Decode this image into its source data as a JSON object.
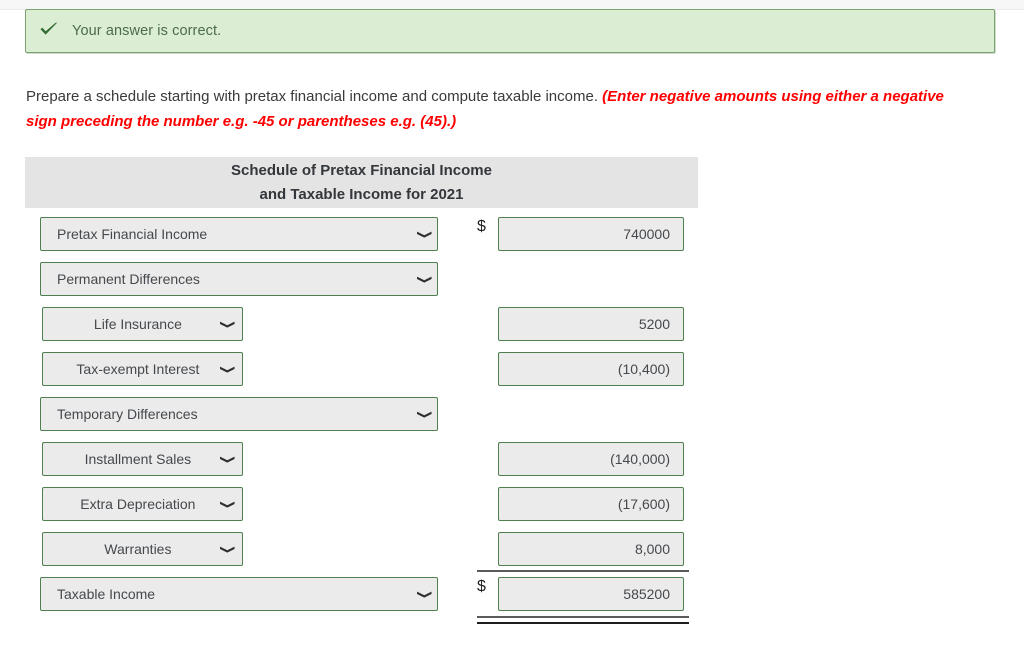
{
  "alert": {
    "icon": "checkmark-icon",
    "message": "Your answer is correct."
  },
  "instruction": {
    "main": "Prepare a schedule starting with pretax financial income and compute taxable income. ",
    "emphasis": "(Enter negative amounts using either a negative sign preceding the number e.g. -45 or parentheses e.g. (45).)"
  },
  "schedule": {
    "title_line1": "Schedule of Pretax Financial Income",
    "title_line2": "and Taxable Income for 2021",
    "currency_symbol": "$",
    "rows": [
      {
        "id": "pretax-financial-income",
        "label": "Pretax Financial Income",
        "style": "wide",
        "currency": true,
        "amount": "740000",
        "has_amount": true
      },
      {
        "id": "permanent-differences",
        "label": "Permanent Differences",
        "style": "wide",
        "currency": false,
        "amount": "",
        "has_amount": false
      },
      {
        "id": "life-insurance",
        "label": "Life Insurance",
        "style": "indent",
        "currency": false,
        "amount": "5200",
        "has_amount": true
      },
      {
        "id": "tax-exempt-interest",
        "label": "Tax-exempt Interest",
        "style": "indent",
        "currency": false,
        "amount": "(10,400)",
        "has_amount": true
      },
      {
        "id": "temporary-differences",
        "label": "Temporary Differences",
        "style": "wide",
        "currency": false,
        "amount": "",
        "has_amount": false
      },
      {
        "id": "installment-sales",
        "label": "Installment Sales",
        "style": "indent",
        "currency": false,
        "amount": "(140,000)",
        "has_amount": true
      },
      {
        "id": "extra-depreciation",
        "label": "Extra Depreciation",
        "style": "indent",
        "currency": false,
        "amount": "(17,600)",
        "has_amount": true
      },
      {
        "id": "warranties",
        "label": "Warranties",
        "style": "indent",
        "currency": false,
        "amount": "8,000",
        "has_amount": true
      },
      {
        "id": "taxable-income",
        "label": "Taxable Income",
        "style": "wide",
        "currency": true,
        "amount": "585200",
        "has_amount": true
      }
    ]
  },
  "colors": {
    "alert_bg": "#dbedd3",
    "alert_border": "#79a46f",
    "alert_text": "#4d6b4d",
    "emphasis_red": "#ff0000",
    "field_bg": "#ebebeb",
    "field_border": "#4e7f4f",
    "header_bg": "#e4e4e4"
  }
}
